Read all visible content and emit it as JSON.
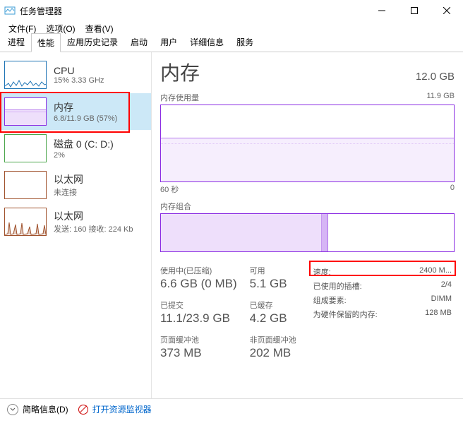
{
  "window": {
    "title": "任务管理器"
  },
  "menu": {
    "file": "文件(F)",
    "options": "选项(O)",
    "view": "查看(V)"
  },
  "tabs": [
    "进程",
    "性能",
    "应用历史记录",
    "启动",
    "用户",
    "详细信息",
    "服务"
  ],
  "activeTab": 1,
  "sidebar": {
    "items": [
      {
        "name": "CPU",
        "sub": "15% 3.33 GHz",
        "kind": "cpu"
      },
      {
        "name": "内存",
        "sub": "6.8/11.9 GB (57%)",
        "kind": "mem",
        "selected": true
      },
      {
        "name": "磁盘 0 (C: D:)",
        "sub": "2%",
        "kind": "disk"
      },
      {
        "name": "以太网",
        "sub": "未连接",
        "kind": "eth0"
      },
      {
        "name": "以太网",
        "sub": "发送: 160 接收: 224 Kb",
        "kind": "eth"
      }
    ]
  },
  "detail": {
    "title": "内存",
    "total": "12.0 GB",
    "usageChart": {
      "label": "内存使用量",
      "max": "11.9 GB",
      "span": "60 秒",
      "zero": "0"
    },
    "compChart": {
      "label": "内存组合"
    },
    "stats": [
      [
        {
          "k": "使用中(已压缩)",
          "v": "6.6 GB (0 MB)"
        },
        {
          "k": "已提交",
          "v": "11.1/23.9 GB"
        },
        {
          "k": "页面缓冲池",
          "v": "373 MB"
        }
      ],
      [
        {
          "k": "可用",
          "v": "5.1 GB"
        },
        {
          "k": "已缓存",
          "v": "4.2 GB"
        },
        {
          "k": "非页面缓冲池",
          "v": "202 MB"
        }
      ]
    ],
    "specs": [
      {
        "k": "速度:",
        "v": "2400 M..."
      },
      {
        "k": "已使用的插槽:",
        "v": "2/4"
      },
      {
        "k": "组成要素:",
        "v": "DIMM"
      },
      {
        "k": "为硬件保留的内存:",
        "v": "128 MB"
      }
    ]
  },
  "footer": {
    "brief": "简略信息(D)",
    "resmon": "打开资源监视器"
  }
}
